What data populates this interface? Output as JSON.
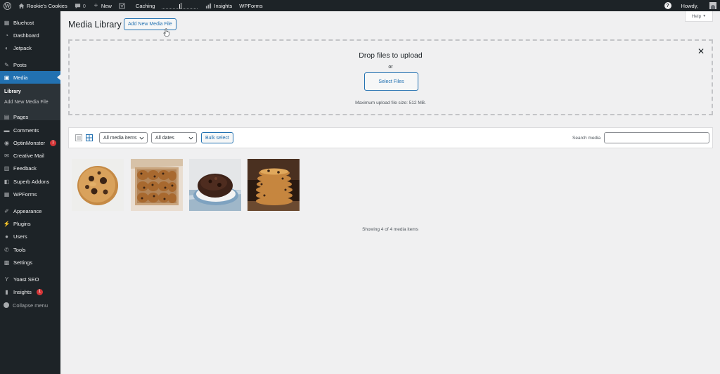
{
  "admin_bar": {
    "site_name": "Rookie's Cookies",
    "comments_count": "0",
    "new_label": "New",
    "caching_label": "Caching",
    "insights_label": "Insights",
    "wpforms_label": "WPForms",
    "howdy_label": "Howdy,"
  },
  "sidebar": {
    "items": [
      {
        "label": "Bluehost",
        "icon": "bluehost-icon"
      },
      {
        "label": "Dashboard",
        "icon": "dashboard-icon"
      },
      {
        "label": "Jetpack",
        "icon": "jetpack-icon"
      },
      {
        "label": "Posts",
        "icon": "pin-icon"
      },
      {
        "label": "Media",
        "icon": "media-icon"
      },
      {
        "label": "Pages",
        "icon": "pages-icon"
      },
      {
        "label": "Comments",
        "icon": "comments-icon"
      },
      {
        "label": "OptinMonster",
        "icon": "optinmonster-icon",
        "badge": "1"
      },
      {
        "label": "Creative Mail",
        "icon": "creative-mail-icon"
      },
      {
        "label": "Feedback",
        "icon": "feedback-icon"
      },
      {
        "label": "Superb Addons",
        "icon": "superb-addons-icon"
      },
      {
        "label": "WPForms",
        "icon": "wpforms-icon"
      },
      {
        "label": "Appearance",
        "icon": "brush-icon"
      },
      {
        "label": "Plugins",
        "icon": "plugin-icon"
      },
      {
        "label": "Users",
        "icon": "users-icon"
      },
      {
        "label": "Tools",
        "icon": "wrench-icon"
      },
      {
        "label": "Settings",
        "icon": "settings-icon"
      },
      {
        "label": "Yoast SEO",
        "icon": "yoast-icon"
      },
      {
        "label": "Insights",
        "icon": "insights-icon",
        "badge": "1"
      }
    ],
    "submenu": [
      "Library",
      "Add New Media File"
    ],
    "collapse_label": "Collapse menu"
  },
  "main": {
    "title": "Media Library",
    "add_new_label": "Add New Media File",
    "help_label": "Help"
  },
  "uploader": {
    "title": "Drop files to upload",
    "or_label": "or",
    "select_files_label": "Select Files",
    "max_size_text": "Maximum upload file size: 512 MB."
  },
  "toolbar": {
    "filter_type": "All media items",
    "filter_date": "All dates",
    "bulk_select_label": "Bulk select",
    "search_label": "Search media",
    "search_value": ""
  },
  "media_items": [
    {
      "name": "cookie-single",
      "icon": "cookie-image"
    },
    {
      "name": "cookies-in-box",
      "icon": "cookie-box-image"
    },
    {
      "name": "chocolate-cookies-plate",
      "icon": "chocolate-cookie-image"
    },
    {
      "name": "cookie-stack",
      "icon": "cookie-stack-image"
    }
  ],
  "showing_text": "Showing 4 of 4 media items",
  "colors": {
    "admin_dark": "#1d2327",
    "accent": "#2271b1",
    "badge_red": "#d63638",
    "background": "#f0f0f1"
  }
}
